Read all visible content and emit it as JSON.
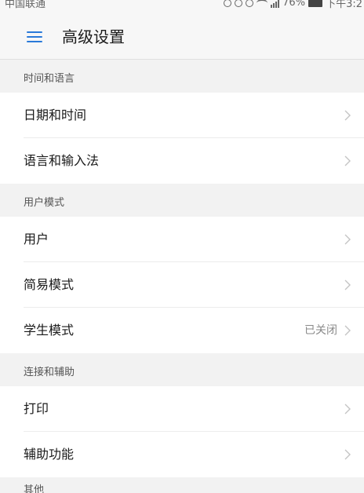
{
  "status_bar": {
    "carrier": "中国联通",
    "battery_percent": "76%",
    "time": "下午3:2"
  },
  "header": {
    "title": "高级设置"
  },
  "sections": [
    {
      "header": "时间和语言",
      "items": [
        {
          "label": "日期和时间",
          "value": ""
        },
        {
          "label": "语言和输入法",
          "value": ""
        }
      ]
    },
    {
      "header": "用户模式",
      "items": [
        {
          "label": "用户",
          "value": ""
        },
        {
          "label": "简易模式",
          "value": ""
        },
        {
          "label": "学生模式",
          "value": "已关闭"
        }
      ]
    },
    {
      "header": "连接和辅助",
      "items": [
        {
          "label": "打印",
          "value": ""
        },
        {
          "label": "辅助功能",
          "value": ""
        }
      ]
    }
  ],
  "next_section_partial": "其他",
  "colors": {
    "accent": "#2a7ad9",
    "background": "#f2f2f2",
    "row_bg": "#ffffff",
    "secondary_text": "#8a8a8a"
  },
  "icons": {
    "menu": "menu-icon",
    "chevron": "chevron-right-icon"
  }
}
